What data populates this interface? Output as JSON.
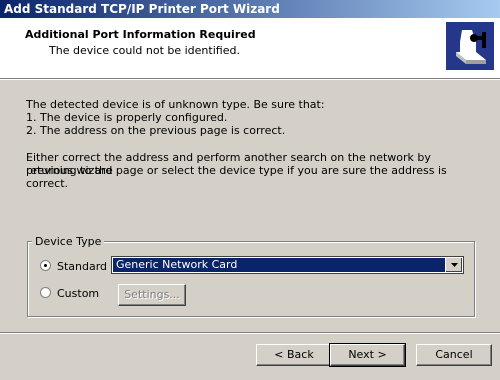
{
  "window": {
    "title": "Add Standard TCP/IP Printer Port Wizard"
  },
  "header": {
    "title": "Additional Port Information Required",
    "subtitle": "The device could not be identified.",
    "icon": "printer-wizard-icon"
  },
  "body": {
    "line1": "The detected device is of unknown type.  Be sure that:",
    "line2": "1. The device is properly configured.",
    "line3": "2.  The address on the previous page is correct.",
    "line4": "Either correct the address and perform another search on the network by returning to the",
    "line5": "previous wizard page or select the device type if you are sure the address is correct."
  },
  "device_type": {
    "legend": "Device Type",
    "standard_label": "Standard",
    "custom_label": "Custom",
    "selected": "standard",
    "select_value": "Generic Network Card",
    "settings_label": "Settings..."
  },
  "buttons": {
    "back": "< Back",
    "next": "Next >",
    "cancel": "Cancel"
  },
  "colors": {
    "title_bar": "#0a246a",
    "selection": "#0a246a",
    "dialog_bg": "#d4d0c8"
  }
}
